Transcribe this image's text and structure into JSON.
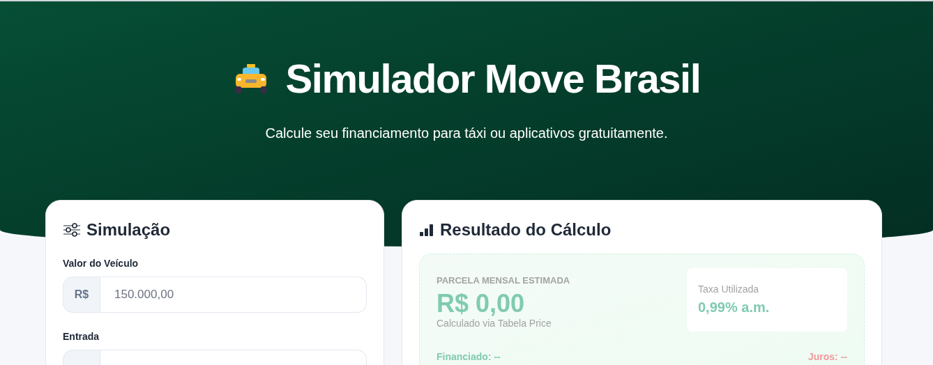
{
  "header": {
    "title": "Simulador Move Brasil",
    "subtitle": "Calcule seu financiamento para táxi ou aplicativos gratuitamente."
  },
  "simulation": {
    "title": "Simulação",
    "fields": [
      {
        "label": "Valor do Veículo",
        "prefix": "R$",
        "placeholder": "150.000,00"
      },
      {
        "label": "Entrada"
      }
    ]
  },
  "result": {
    "title": "Resultado do Cálculo",
    "installment_label": "PARCELA MENSAL ESTIMADA",
    "installment_value": "R$ 0,00",
    "method": "Calculado via Tabela Price",
    "rate_label": "Taxa Utilizada",
    "rate_value": "0,99% a.m.",
    "financed": "Financiado: --",
    "interest": "Juros: --"
  }
}
